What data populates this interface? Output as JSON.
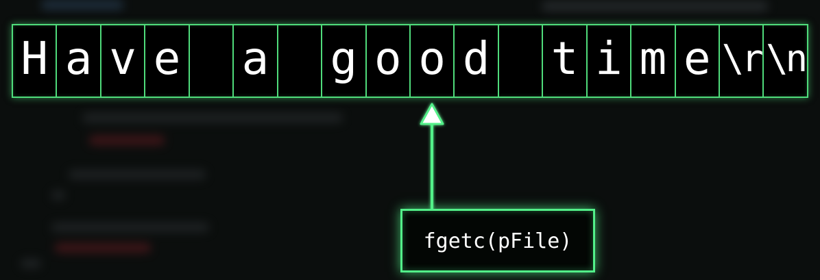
{
  "characters": [
    "H",
    "a",
    "v",
    "e",
    "",
    "a",
    "",
    "g",
    "o",
    "o",
    "d",
    "",
    "t",
    "i",
    "m",
    "e",
    "\\r",
    "\\n"
  ],
  "function_call": "fgetc(pFile)",
  "colors": {
    "accent": "#4fdc7b",
    "background": "#0b0e0d",
    "text": "#ffffff"
  },
  "arrow_target_index": 9
}
